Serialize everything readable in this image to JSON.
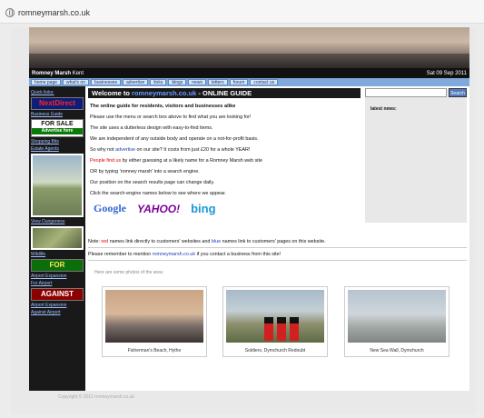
{
  "browser": {
    "tab_title": "romneymarsh.co.uk",
    "tab_icon": "globe-icon"
  },
  "banner": {
    "left": "Romney Marsh",
    "left_small": "Kent",
    "date": "Sat 09 Sep 2011"
  },
  "nav": [
    "home page",
    "what's on",
    "businesses",
    "advertise",
    "links",
    "blogs",
    "news",
    "letters",
    "forum",
    "contact us"
  ],
  "left": {
    "quick_links": "Quick links:",
    "red_ad": "NextDirect",
    "business_guide": "Business Guide",
    "for_sale_top": "FOR SALE",
    "for_sale_bottom": "Advertise here",
    "shopping_link": "Shopping Bits",
    "estate_link": "Estate Agents",
    "photo_caption": "View Dungeness",
    "wildlife_caption": "Wildlife",
    "for_ad": "FOR",
    "for_caption": "Airport Expansion",
    "for_link": "For Airport",
    "against_ad": "AGAINST",
    "against_caption": "Airport Expansion",
    "against_link": "Against Airport"
  },
  "main": {
    "heading_prefix": "Welcome to",
    "heading_site": "romneymarsh.co.uk",
    "heading_suffix": "- ONLINE GUIDE",
    "intro_bold": "The online guide for residents, visitors and businesses alike",
    "p1": "Please use the menu or search box above to find what you are looking for!",
    "p2": "The site uses a dutterless design with easy-to-find items.",
    "p3": "We are independent of any outside body and operate on a not-for-profit basis.",
    "p4_prefix": "So why not",
    "p4_link": "advertise",
    "p4_suffix": "on our site? It costs from just £20 for a whole YEAR!",
    "p5_red": "People find us",
    "p5_rest": "by either guessing at a likely name for a Romney Marsh web site",
    "p6": "OR by typing 'romney marsh' into a search engine.",
    "p7": "Our position on the search results page can change daily.",
    "p8": "Click the search-engine names below to see where we appear.",
    "google": "Google",
    "yahoo": "YAHOO!",
    "bing": "bing"
  },
  "right": {
    "search_placeholder": "",
    "search_button": "Search",
    "latest_label": "latest news:"
  },
  "note": {
    "prefix": "Note:",
    "red": "red",
    "middle": "names link directly to customers' websites and",
    "blue": "blue",
    "end": "names link to customers' pages on this website.",
    "remember_prefix": "Please remember to mention",
    "remember_link": "romneymarsh.co.uk",
    "remember_suffix": "if you contact a business from this site!"
  },
  "photos": {
    "intro": "Here are some photos of the area:",
    "items": [
      "Fisherman's Beach, Hythe",
      "Soldiers, Dymchurch Redoubt",
      "New Sea Wall, Dymchurch"
    ]
  },
  "footer": "Copyright © 2011 romneymarsh.co.uk"
}
